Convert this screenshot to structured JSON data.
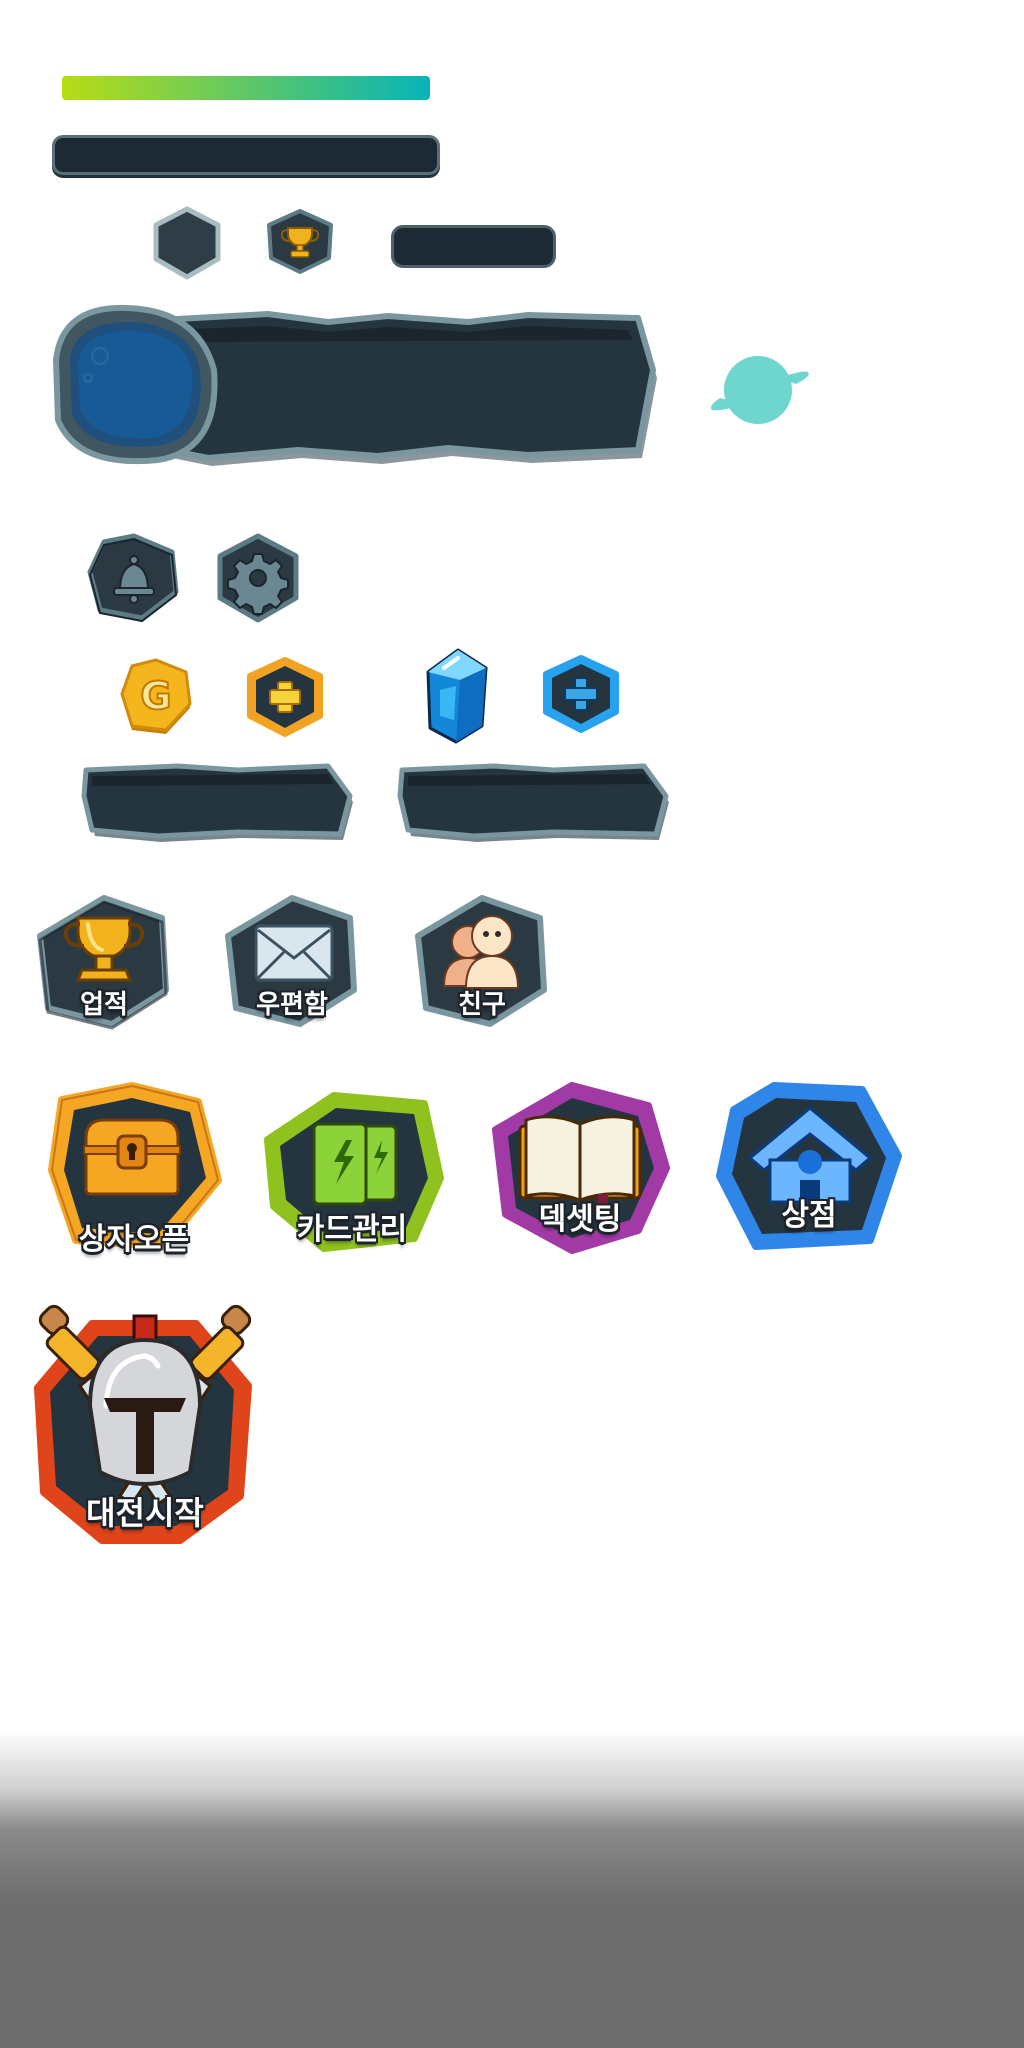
{
  "hud": {
    "progress_fraction": 1.0,
    "progress_colors": [
      "#b8dc14",
      "#06b4b8"
    ],
    "panel_color": "#1d2a33",
    "border_color": "#5d7b85"
  },
  "icons": {
    "top_hex": "hexagon-icon",
    "trophy_small": "trophy-icon",
    "planet": "planet-icon",
    "bell": "bell-icon",
    "gear": "gear-icon",
    "gold": "gold-coin-icon",
    "gem": "blue-gem-icon"
  },
  "currency": {
    "gold_symbol": "G"
  },
  "menu_small": [
    {
      "label": "업적",
      "icon": "trophy-icon"
    },
    {
      "label": "우편함",
      "icon": "mail-icon"
    },
    {
      "label": "친구",
      "icon": "friends-icon"
    }
  ],
  "menu_large": [
    {
      "label": "상자오픈",
      "icon": "chest-icon",
      "color": "#f5a623"
    },
    {
      "label": "카드관리",
      "icon": "cards-icon",
      "color": "#8fc21e"
    },
    {
      "label": "덱셋팅",
      "icon": "book-icon",
      "color": "#a23aa6"
    },
    {
      "label": "상점",
      "icon": "shop-icon",
      "color": "#2f86e8"
    }
  ],
  "battle": {
    "label": "대전시작",
    "icon": "knight-helmet-icon",
    "color": "#e0441a"
  }
}
